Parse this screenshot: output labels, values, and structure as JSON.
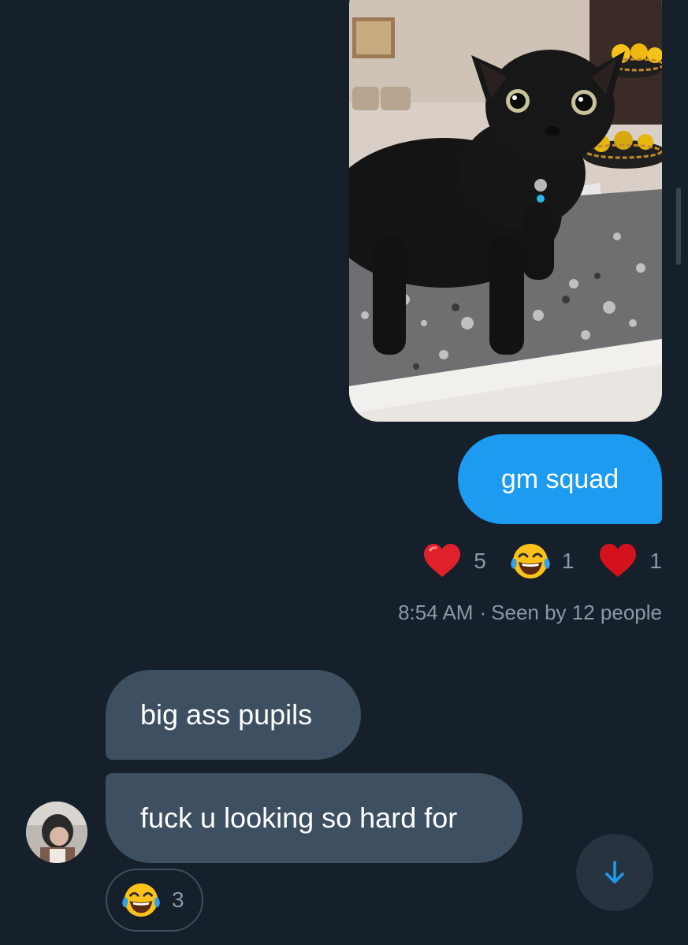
{
  "thread": {
    "photo_message": {
      "icon": "black-cat-photo"
    },
    "outgoing_message": {
      "text": "gm squad"
    },
    "reactions": [
      {
        "emoji": "red-heart",
        "count": "5"
      },
      {
        "emoji": "face-with-tears-of-joy",
        "count": "1"
      },
      {
        "emoji": "red-heart",
        "count": "1"
      }
    ],
    "meta": {
      "time": "8:54 AM",
      "separator": "·",
      "seen": "Seen by 12 people"
    },
    "incoming_messages": [
      {
        "text": "big ass pupils"
      },
      {
        "text": "fuck u looking so hard for"
      }
    ],
    "incoming_reaction": {
      "emoji": "face-with-tears-of-joy",
      "count": "3"
    },
    "scroll_down": {
      "icon": "arrow-down-icon"
    }
  },
  "colors": {
    "background": "#15202b",
    "outgoing_bubble": "#1d9bf0",
    "incoming_bubble": "#3d4f60",
    "muted_text": "#8b98a5"
  }
}
